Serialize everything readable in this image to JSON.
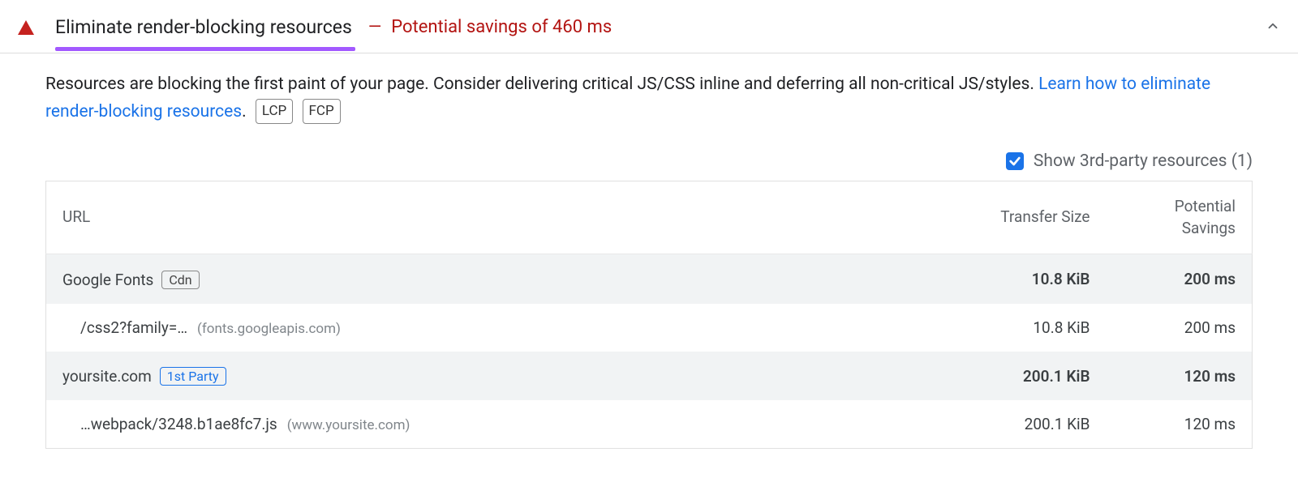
{
  "audit": {
    "title": "Eliminate render-blocking resources",
    "savings_sep": "—",
    "savings_text": "Potential savings of 460 ms",
    "description": "Resources are blocking the first paint of your page. Consider delivering critical JS/CSS inline and deferring all non-critical JS/styles. ",
    "learn_link": "Learn how to eliminate render-blocking resources",
    "learn_period": ".",
    "metric_tags": [
      "LCP",
      "FCP"
    ],
    "third_party": {
      "label": "Show 3rd-party resources (1)",
      "checked": true
    },
    "table": {
      "headers": {
        "url": "URL",
        "size": "Transfer Size",
        "savings": "Potential Savings"
      },
      "groups": [
        {
          "name": "Google Fonts",
          "badge": "Cdn",
          "badge_style": "grey",
          "size": "10.8 KiB",
          "savings": "200 ms",
          "items": [
            {
              "path": "/css2?family=…",
              "host": "(fonts.googleapis.com)",
              "size": "10.8 KiB",
              "savings": "200 ms"
            }
          ]
        },
        {
          "name": "yoursite.com",
          "badge": "1st Party",
          "badge_style": "blue",
          "size": "200.1 KiB",
          "savings": "120 ms",
          "items": [
            {
              "path": "…webpack/3248.b1ae8fc7.js",
              "host": "(www.yoursite.com)",
              "size": "200.1 KiB",
              "savings": "120 ms"
            }
          ]
        }
      ]
    }
  }
}
